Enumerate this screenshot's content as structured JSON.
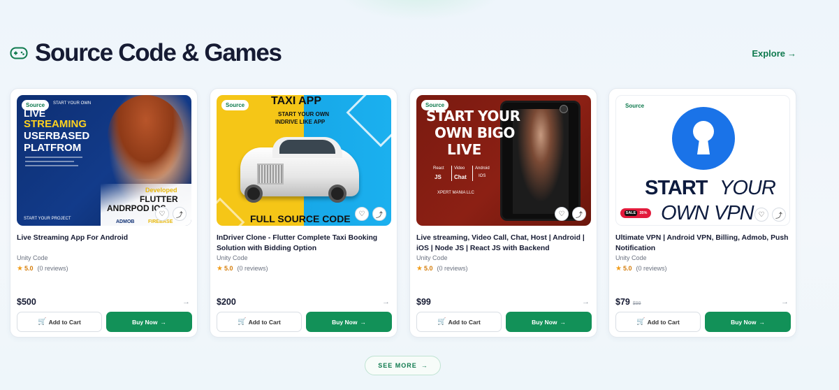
{
  "section": {
    "title": "Source Code & Games",
    "icon": "gamepad-icon",
    "explore_label": "Explore"
  },
  "cards": [
    {
      "badge": "Source",
      "thumb": {
        "lines": [
          "START YOUR OWN",
          "LIVE",
          "STREAMING",
          "USERBASED",
          "PLATFROM",
          "Developed",
          "FLUTTER",
          "ANDRPOD IOS",
          "START YOUR PROJECT",
          "ADMOB",
          "FIREBASE"
        ]
      },
      "title": "Live Streaming App For Android",
      "vendor": "Unity Code",
      "rating": "5.0",
      "reviews": "(0 reviews)",
      "price": "$500",
      "old_price": "",
      "add_to_cart": "Add to Cart",
      "buy_now": "Buy Now"
    },
    {
      "badge": "Source",
      "thumb": {
        "lines": [
          "TAXI APP",
          "START YOUR OWN",
          "INDRIVE LIKE APP",
          "FULL SOURCE CODE"
        ]
      },
      "title": "InDriver Clone - Flutter Complete Taxi Booking Solution with Bidding Option",
      "vendor": "Unity Code",
      "rating": "5.0",
      "reviews": "(0 reviews)",
      "price": "$200",
      "old_price": "",
      "add_to_cart": "Add to Cart",
      "buy_now": "Buy Now"
    },
    {
      "badge": "Source",
      "thumb": {
        "lines": [
          "START YOUR",
          "OWN BIGO",
          "LIVE",
          "React",
          "JS",
          "Video",
          "Chat",
          "Android",
          "IOS",
          "XPERT MANIA LLC"
        ]
      },
      "title": "Live streaming, Video Call, Chat, Host | Android | iOS | Node JS | React JS with Backend",
      "vendor": "Unity Code",
      "rating": "5.0",
      "reviews": "(0 reviews)",
      "price": "$99",
      "old_price": "",
      "add_to_cart": "Add to Cart",
      "buy_now": "Buy Now"
    },
    {
      "badge": "Source",
      "thumb": {
        "lines": [
          "START",
          "YOUR",
          "OWN",
          "VPN",
          "SALE",
          "35%"
        ]
      },
      "title": "Ultimate VPN | Android VPN, Billing, Admob, Push Notification",
      "vendor": "Unity Code",
      "rating": "5.0",
      "reviews": "(0 reviews)",
      "price": "$79",
      "old_price": "$99",
      "add_to_cart": "Add to Cart",
      "buy_now": "Buy Now"
    }
  ],
  "see_more_label": "SEE MORE",
  "colors": {
    "brand_green": "#129158",
    "star": "#f29d1a",
    "title": "#161b33"
  }
}
